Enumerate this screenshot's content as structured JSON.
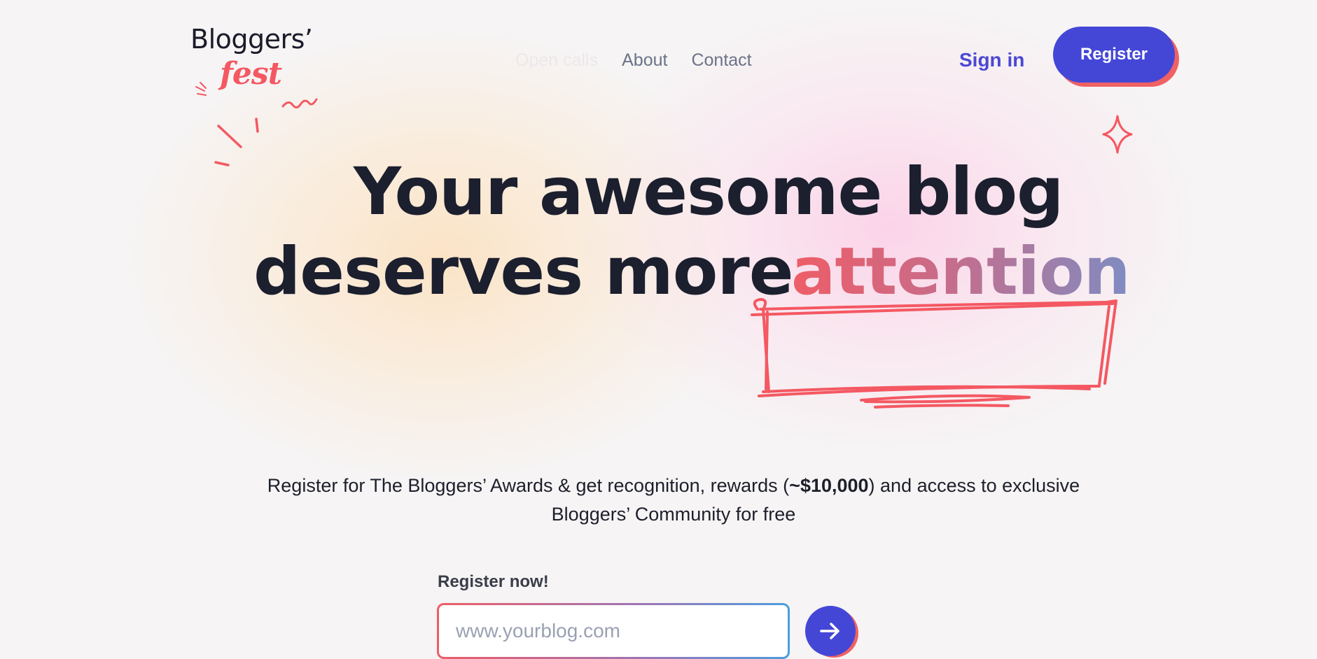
{
  "logo": {
    "line1": "Bloggers’",
    "line2": "fest"
  },
  "nav": {
    "items": [
      {
        "label": "Open calls"
      },
      {
        "label": "About"
      },
      {
        "label": "Contact"
      }
    ]
  },
  "header": {
    "signin_label": "Sign in",
    "register_label": "Register"
  },
  "hero": {
    "line1": "Your awesome blog",
    "line2": "deserves more",
    "accent": "attention"
  },
  "subtitle": {
    "before": "Register for The Bloggers’ Awards & get recognition, rewards (",
    "amount": "~$10,000",
    "after": ") and access to exclusive Bloggers’ Community for free"
  },
  "form": {
    "label": "Register now!",
    "placeholder": "www.yourblog.com",
    "value": ""
  },
  "colors": {
    "brand_blue": "#4447d6",
    "accent_red": "#f06163",
    "text_dark": "#1b1f2e"
  },
  "icons": [
    "sparkle-icon",
    "arrow-right-icon",
    "scribble-box-icon"
  ]
}
